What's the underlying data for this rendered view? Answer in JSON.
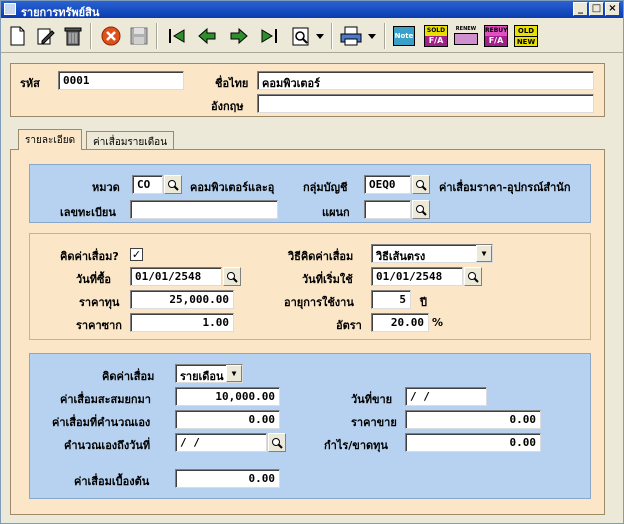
{
  "window": {
    "title": "รายการทรัพย์สิน",
    "controls": [
      "_",
      "□",
      "×"
    ]
  },
  "toolbar": {
    "icons": [
      "new-icon",
      "edit-icon",
      "delete-icon",
      "cancel-icon",
      "save-icon",
      "first-icon",
      "prev-icon",
      "next-icon",
      "last-icon",
      "find-icon",
      "dropdown-icon",
      "print-icon",
      "dropdown-icon",
      "note-icon",
      "sold-fa-icon",
      "renew-icon",
      "rebuy-fa-icon",
      "old-new-icon"
    ],
    "note_label": "Note",
    "sold_top": "SOLD",
    "sold_bottom": "F/A",
    "renew_top": "RENEW",
    "rebuy_top": "REBUY",
    "rebuy_bottom": "F/A",
    "old_top": "OLD",
    "old_bottom": "NEW"
  },
  "header": {
    "code_label": "รหัส",
    "code_value": "0001",
    "thai_name_label": "ชื่อไทย",
    "thai_name_value": "คอมพิวเตอร์",
    "eng_name_label": "อังกฤษ",
    "eng_name_value": ""
  },
  "tabs": [
    {
      "label": "รายละเอียด",
      "active": true
    },
    {
      "label": "ค่าเสื่อมรายเดือน",
      "active": false
    }
  ],
  "category": {
    "category_label": "หมวด",
    "category_code": "CO",
    "category_name": "คอมพิวเตอร์และอุ",
    "account_group_label": "กลุ่มบัญชี",
    "account_group_code": "OEQ0",
    "account_group_name": "ค่าเสื่อมราคา-อุปกรณ์สำนัก",
    "reg_no_label": "เลขทะเบียน",
    "reg_no_value": "",
    "dept_label": "แผนก",
    "dept_value": ""
  },
  "depreciation": {
    "calc_label": "คิดค่าเสื่อม?",
    "calc_checked": "✓",
    "method_label": "วิธีคิดค่าเสื่อม",
    "method_value": "วิธีเส้นตรง",
    "buy_date_label": "วันที่ซื้อ",
    "buy_date_value": "01/01/2548",
    "start_date_label": "วันที่เริ่มใช้",
    "start_date_value": "01/01/2548",
    "cost_label": "ราคาทุน",
    "cost_value": "25,000.00",
    "life_label": "อายุการใช้งาน",
    "life_value": "5",
    "life_unit": "ปี",
    "salvage_label": "ราคาซาก",
    "salvage_value": "1.00",
    "rate_label": "อัตรา",
    "rate_value": "20.00",
    "rate_unit": "%"
  },
  "summary": {
    "period_label": "คิดค่าเสื่อม",
    "period_value": "รายเดือน",
    "accum_label": "ค่าเสื่อมสะสมยกมา",
    "accum_value": "10,000.00",
    "manual_label": "ค่าเสื่อมที่คำนวณเอง",
    "manual_value": "0.00",
    "calc_to_label": "คำนวณเองถึงวันที่",
    "calc_to_value": " / /",
    "sell_date_label": "วันที่ขาย",
    "sell_date_value": " / /",
    "sell_price_label": "ราคาขาย",
    "sell_price_value": "0.00",
    "profit_label": "กำไร/ขาดทุน",
    "profit_value": "0.00",
    "initial_label": "ค่าเสื่อมเบื้องต้น",
    "initial_value": "0.00"
  }
}
